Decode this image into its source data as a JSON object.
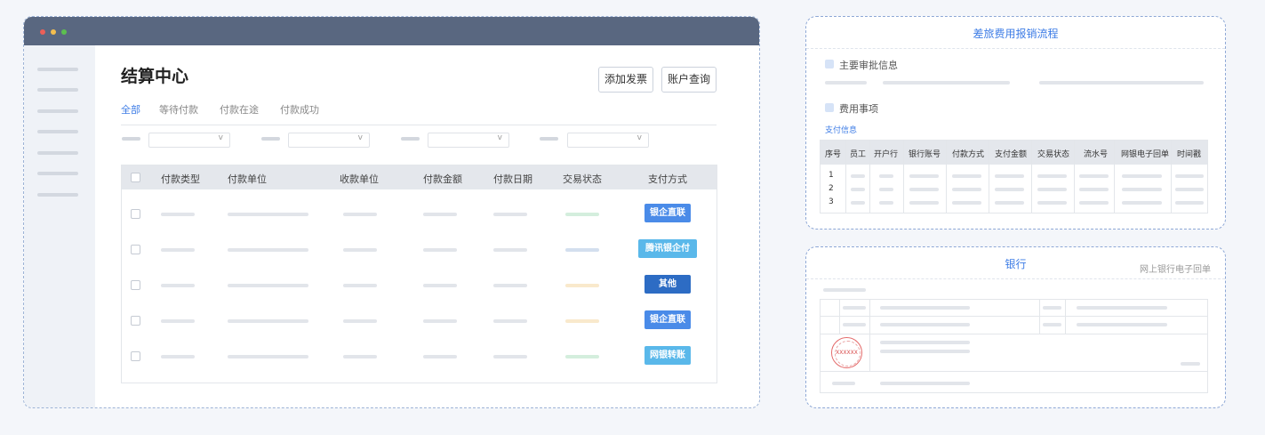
{
  "main": {
    "title": "结算中心",
    "buttons": {
      "add_invoice": "添加发票",
      "account_query": "账户查询"
    },
    "tabs": [
      "全部",
      "等待付款",
      "付款在途",
      "付款成功"
    ],
    "filter_chevron": "v",
    "columns": [
      "付款类型",
      "付款单位",
      "收款单位",
      "付款金额",
      "付款日期",
      "交易状态",
      "支付方式"
    ],
    "rows": [
      {
        "pay_method": "银企直联",
        "status_color": "#d4eedd",
        "tag_color": "#4a8be8"
      },
      {
        "pay_method": "腾讯银企付",
        "status_color": "#d3dfee",
        "tag_color": "#5ab8ea"
      },
      {
        "pay_method": "其他",
        "status_color": "#f9e9cc",
        "tag_color": "#2d6cc4"
      },
      {
        "pay_method": "银企直联",
        "status_color": "#f9e9cc",
        "tag_color": "#4a8be8"
      },
      {
        "pay_method": "网银转账",
        "status_color": "#d4eedd",
        "tag_color": "#5ab8ea"
      }
    ]
  },
  "travel": {
    "title": "差旅费用报销流程",
    "section1": "主要审批信息",
    "section2": "费用事项",
    "pay_info": "支付信息",
    "columns": [
      "序号",
      "员工",
      "开户行",
      "银行账号",
      "付款方式",
      "支付金额",
      "交易状态",
      "流水号",
      "网银电子回单",
      "时间戳"
    ],
    "rows": [
      "1",
      "2",
      "3"
    ]
  },
  "bank": {
    "title": "银行",
    "subtitle": "网上银行电子回单",
    "seal_text": "XXXXXX"
  },
  "colors": {
    "accent": "#3d7ce6",
    "titlebar": "#596780"
  },
  "icons": [
    "window-close-dot",
    "window-minimize-dot",
    "window-maximize-dot",
    "checkbox-icon",
    "chevron-down-icon",
    "square-bullet-icon",
    "red-seal-icon"
  ]
}
